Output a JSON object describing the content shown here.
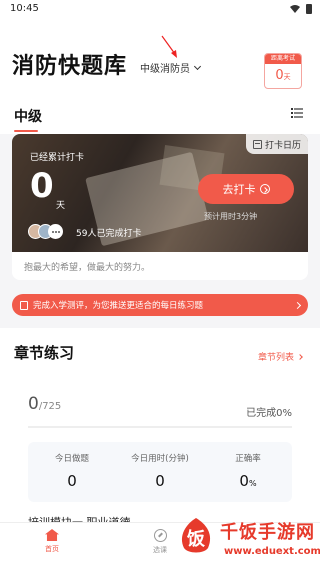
{
  "status_bar": {
    "time": "10:45"
  },
  "header": {
    "app_title": "消防快题库",
    "level_selector": "中级消防员",
    "exam_countdown": {
      "label": "距离考试",
      "days": "0",
      "unit": "天"
    }
  },
  "level_section": {
    "title": "中级"
  },
  "checkin": {
    "calendar_label": "打卡日历",
    "accum_label": "已经累计打卡",
    "accum_days": "0",
    "accum_unit": "天",
    "button_label": "去打卡",
    "estimate": "预计用时3分钟",
    "completed": "59人已完成打卡",
    "motto": "抱最大的希望，做最大的努力。"
  },
  "assessment_banner": {
    "text": "完成入学测评，为您推送更适合的每日练习题"
  },
  "chapter": {
    "title": "章节练习",
    "list_link": "章节列表",
    "progress_done": "0",
    "progress_total": "/725",
    "completed_label": "已完成",
    "completed_value": "0",
    "completed_unit": "%",
    "progress_fraction": 0,
    "stats": [
      {
        "label": "今日做题",
        "value": "0",
        "unit": ""
      },
      {
        "label": "今日用时(分钟)",
        "value": "0",
        "unit": ""
      },
      {
        "label": "正确率",
        "value": "0",
        "unit": "%"
      }
    ],
    "module_title": "培训模块一 职业道德"
  },
  "tab_bar": {
    "tabs": [
      {
        "label": "首页",
        "icon": "home-icon",
        "active": true
      },
      {
        "label": "选课",
        "icon": "compass-icon",
        "active": false
      }
    ]
  },
  "watermark": {
    "logo_char": "饭",
    "title": "千饭手游网",
    "url": "www.eduext.com"
  },
  "colors": {
    "accent": "#f15a4a",
    "watermark": "#e63a2b"
  },
  "icons": [
    "wifi-icon",
    "battery-icon",
    "chevron-down-icon",
    "list-icon",
    "calendar-icon",
    "circle-arrow-icon",
    "document-icon",
    "chevron-right-icon",
    "home-icon",
    "compass-icon",
    "red-arrow-icon"
  ]
}
